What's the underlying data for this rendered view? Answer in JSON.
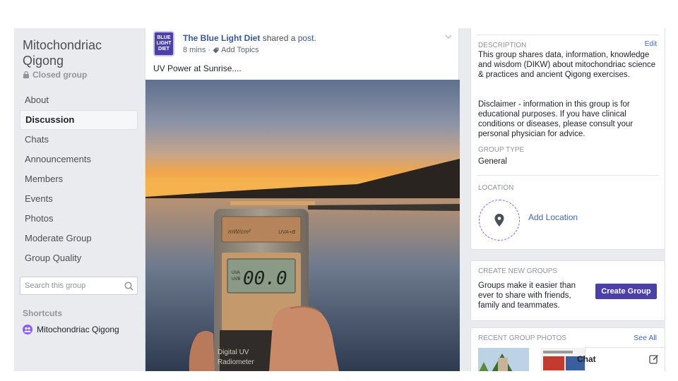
{
  "group": {
    "name": "Mitochondriac Qigong",
    "privacy": "Closed group"
  },
  "nav": [
    {
      "label": "About",
      "active": false
    },
    {
      "label": "Discussion",
      "active": true
    },
    {
      "label": "Chats",
      "active": false
    },
    {
      "label": "Announcements",
      "active": false
    },
    {
      "label": "Members",
      "active": false
    },
    {
      "label": "Events",
      "active": false
    },
    {
      "label": "Photos",
      "active": false
    },
    {
      "label": "Moderate Group",
      "active": false
    },
    {
      "label": "Group Quality",
      "active": false
    }
  ],
  "search": {
    "placeholder": "Search this group"
  },
  "shortcuts": {
    "heading": "Shortcuts",
    "items": [
      {
        "label": "Mitochondriac Qigong"
      }
    ]
  },
  "post": {
    "page_name": "The Blue Light Diet",
    "avatar_text": "BLUE LIGHT DIET",
    "shared_text": "shared a",
    "post_link": "post.",
    "time": "8 mins",
    "add_topics": "Add Topics",
    "text": "UV Power at Sunrise....",
    "device": {
      "unit_label": "mW/cm²",
      "band_label": "UVA+B",
      "reading": "00.0",
      "uva": "UVA",
      "uvb": "UVB",
      "caption_line1": "Digital UV",
      "caption_line2": "Radiometer"
    }
  },
  "about_card": {
    "description_label": "DESCRIPTION",
    "edit_label": "Edit",
    "description_p1": "This group shares data, information, knowledge and wisdom (DIKW) about mitochondriac science & practices and ancient Qigong exercises.",
    "description_p2": "Disclaimer - information in this group is for educational purposes. If you have clinical conditions or diseases, please consult your personal physician for advice.",
    "group_type_label": "GROUP TYPE",
    "group_type_value": "General",
    "location_label": "LOCATION",
    "add_location": "Add Location"
  },
  "create_card": {
    "heading": "CREATE NEW GROUPS",
    "text": "Groups make it easier than ever to share with friends, family and teammates.",
    "button": "Create Group"
  },
  "photos_card": {
    "heading": "RECENT GROUP PHOTOS",
    "see_all": "See All"
  },
  "chat": {
    "label": "Chat"
  },
  "colors": {
    "accent": "#4b3fa8",
    "link": "#365899",
    "sidebar_bg": "#e9ebee"
  }
}
